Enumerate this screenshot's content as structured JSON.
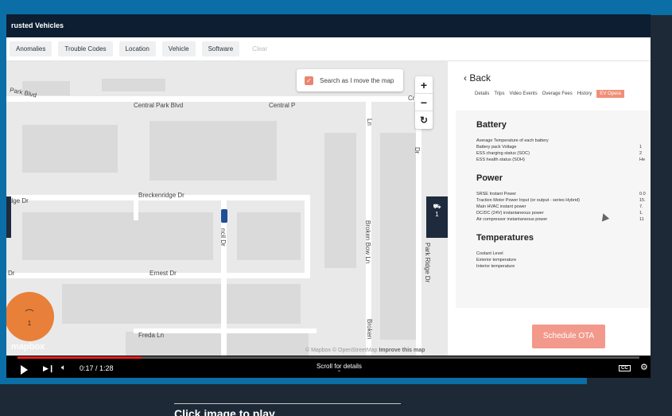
{
  "app": {
    "title": "rusted Vehicles"
  },
  "filters": [
    "Anomalies",
    "Trouble Codes",
    "Location",
    "Vehicle",
    "Software"
  ],
  "filter_clear": "Clear",
  "map": {
    "search_label": "Search as I move the map",
    "search_checked": true,
    "zoom_in": "+",
    "zoom_out": "−",
    "reset": "↻",
    "roads": {
      "r1": "Park Blvd",
      "r2": "Central Park Blvd",
      "r3": "Central P",
      "r4": "Breckenridge Dr",
      "r5": "idge Dr",
      "r6": "Ernest Dr",
      "r7": "Freda Ln",
      "r8": "Broken Bow Ln",
      "r9": "Park Ridge Dr",
      "r10": "Cr",
      "r11": "Dr",
      "r12": "Broken",
      "r13": "Dr",
      "r14": "Ln",
      "r15": "ncil Dr"
    },
    "right_tab": "1",
    "fab_count": "1",
    "logo": "mapbox",
    "attribution": "© Mapbox © OpenStreetMap",
    "improve": "Improve this map"
  },
  "panel": {
    "back": "Back",
    "tabs": [
      "Details",
      "Trips",
      "Video Events",
      "Overage Fees",
      "History",
      "EV Opera"
    ],
    "sections": [
      {
        "title": "Battery",
        "rows": [
          {
            "label": "Average Temperature of each battery",
            "value": ""
          },
          {
            "label": "Battery pack Voltage",
            "value": "1"
          },
          {
            "label": "ESS charging status (SOC)",
            "value": "2"
          },
          {
            "label": "ESS health status (SOH)",
            "value": "He"
          }
        ]
      },
      {
        "title": "Power",
        "rows": [
          {
            "label": "SRSE Instant Power",
            "value": "0.0"
          },
          {
            "label": "Traction Motor Power Input (or output - series Hybrid)",
            "value": "15."
          },
          {
            "label": "Main HVAC instant power",
            "value": "7."
          },
          {
            "label": "DC/DC (24V) instantaneous power",
            "value": "1."
          },
          {
            "label": "Air compressor instantaneous power",
            "value": "11"
          }
        ]
      },
      {
        "title": "Temperatures",
        "rows": [
          {
            "label": "Coolant Level",
            "value": ""
          },
          {
            "label": "Exterior temperature",
            "value": ""
          },
          {
            "label": "Interior temperature",
            "value": ""
          }
        ]
      }
    ],
    "ota_button": "Schedule OTA"
  },
  "video": {
    "time": "0:17 / 1:28",
    "progress": 0.2,
    "scroll_hint": "Scroll for details",
    "cc": "CC"
  },
  "caption": "Click image to play",
  "colors": {
    "frame": "#0b6ea6",
    "accent": "#f08f78",
    "fab": "#e8803a"
  }
}
